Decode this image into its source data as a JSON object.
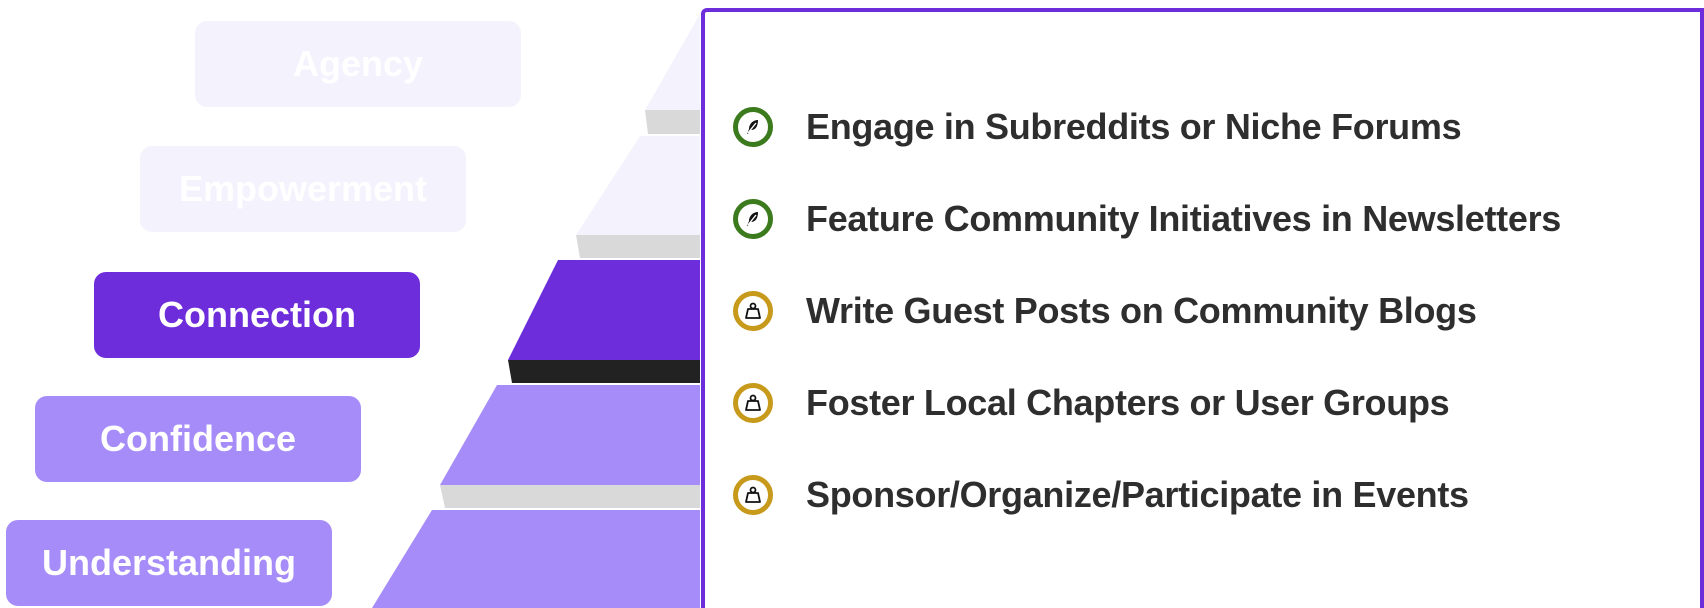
{
  "levels": [
    {
      "label": "Agency",
      "state": "faded"
    },
    {
      "label": "Empowerment",
      "state": "faded"
    },
    {
      "label": "Connection",
      "state": "active"
    },
    {
      "label": "Confidence",
      "state": "light"
    },
    {
      "label": "Understanding",
      "state": "light"
    }
  ],
  "tactics": [
    {
      "text": "Engage in Subreddits or Niche Forums",
      "icon": "feather-icon",
      "color": "#3c7a1e"
    },
    {
      "text": "Feature Community Initiatives in Newsletters",
      "icon": "feather-icon",
      "color": "#3c7a1e"
    },
    {
      "text": "Write Guest Posts on Community Blogs",
      "icon": "weight-icon",
      "color": "#c79a1b"
    },
    {
      "text": "Foster Local Chapters or User Groups",
      "icon": "weight-icon",
      "color": "#c79a1b"
    },
    {
      "text": "Sponsor/Organize/Participate in Events",
      "icon": "weight-icon",
      "color": "#c79a1b"
    }
  ],
  "colors": {
    "accent": "#6d2ddb",
    "light": "#a58cf8",
    "faded": "#f4f2fd",
    "step_shadow": "#d9d9d9",
    "active_shadow": "#222222"
  }
}
